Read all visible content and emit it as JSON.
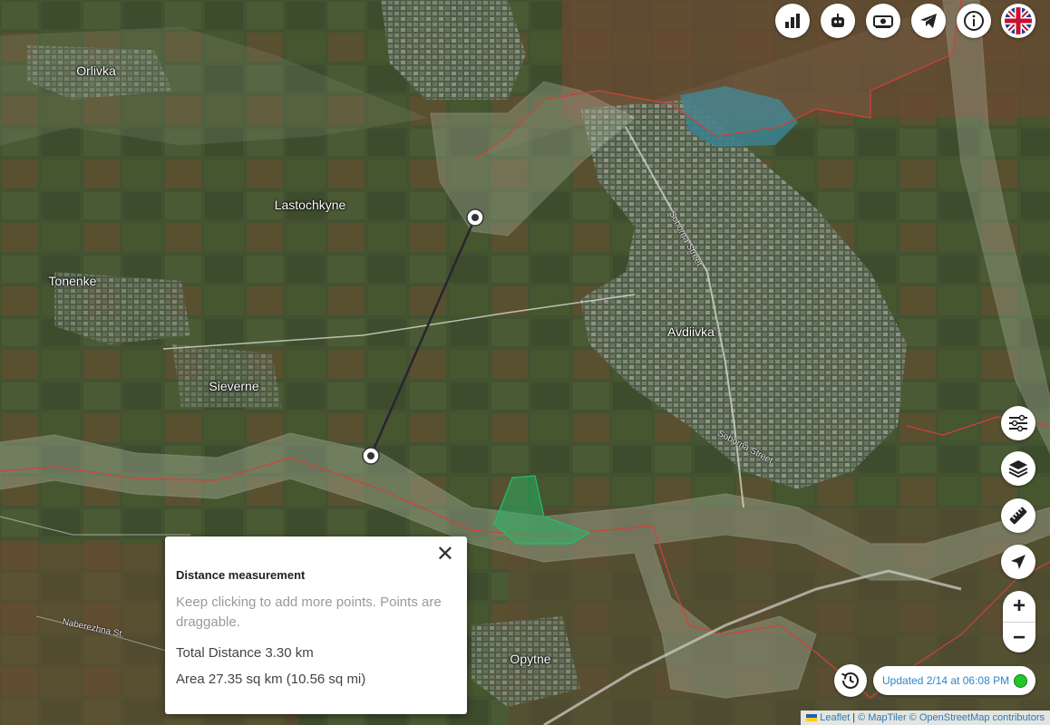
{
  "map": {
    "places": [
      {
        "id": "orlivka",
        "name": "Orlivka"
      },
      {
        "id": "lastochkyne",
        "name": "Lastochkyne"
      },
      {
        "id": "tonenke",
        "name": "Tonenke"
      },
      {
        "id": "sieverne",
        "name": "Sieverne"
      },
      {
        "id": "avdiivka",
        "name": "Avdiivka"
      },
      {
        "id": "opytne",
        "name": "Opytne"
      }
    ],
    "streets": [
      {
        "id": "soborna-1",
        "name": "Soborna Street"
      },
      {
        "id": "soborna-2",
        "name": "Soborna Street"
      },
      {
        "id": "naberezhna",
        "name": "Naberezhna St."
      }
    ],
    "colors": {
      "occupied_border": "#d2403a",
      "grey_zone_fill": "#b7c2ad",
      "recent_change_fill": "#1ec06a",
      "measure_line": "#2a2430"
    }
  },
  "toolbar": {
    "icons": [
      "stats-chart-icon",
      "robot-icon",
      "donate-money-icon",
      "telegram-icon",
      "info-icon",
      "uk-flag-icon"
    ]
  },
  "side_controls": {
    "icons": [
      "filters-sliders-icon",
      "layers-icon",
      "ruler-icon",
      "locate-arrow-icon"
    ],
    "zoom_in": "+",
    "zoom_out": "−"
  },
  "measure_popup": {
    "title": "Distance measurement",
    "hint": "Keep clicking to add more points. Points are draggable.",
    "total_distance": "Total Distance 3.30 km",
    "area": "Area 27.35 sq km (10.56 sq mi)",
    "close": "✕"
  },
  "status": {
    "updated": "Updated 2/14 at 06:08 PM",
    "live_color": "#1fc72c"
  },
  "attribution": {
    "leaflet": "Leaflet",
    "sep1": "|",
    "maptiler": "© MapTiler",
    "osm": "© OpenStreetMap contributors"
  }
}
